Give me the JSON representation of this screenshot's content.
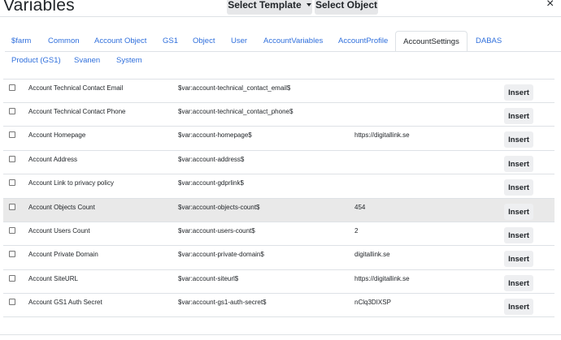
{
  "header": {
    "title": "Variables",
    "select_template_label": "Select Template",
    "select_object_label": "Select Object",
    "close_glyph": "×"
  },
  "tabs": [
    {
      "label": "$farm",
      "active": false
    },
    {
      "label": "Common",
      "active": false
    },
    {
      "label": "Account Object",
      "active": false
    },
    {
      "label": "GS1",
      "active": false
    },
    {
      "label": "Object",
      "active": false
    },
    {
      "label": "User",
      "active": false
    },
    {
      "label": "AccountVariables",
      "active": false
    },
    {
      "label": "AccountProfile",
      "active": false
    },
    {
      "label": "AccountSettings",
      "active": true
    },
    {
      "label": "DABAS",
      "active": false
    },
    {
      "label": "Product (GS1)",
      "active": false
    },
    {
      "label": "Svanen",
      "active": false
    },
    {
      "label": "System",
      "active": false
    }
  ],
  "rows": [
    {
      "name": "Account Technical Contact Email",
      "variable": "$var:account-technical_contact_email$",
      "value": "",
      "action": "Insert",
      "highlighted": false
    },
    {
      "name": "Account Technical Contact Phone",
      "variable": "$var:account-technical_contact_phone$",
      "value": "",
      "action": "Insert",
      "highlighted": false
    },
    {
      "name": "Account Homepage",
      "variable": "$var:account-homepage$",
      "value": "https://digitallink.se",
      "action": "Insert",
      "highlighted": false
    },
    {
      "name": "Account Address",
      "variable": "$var:account-address$",
      "value": "",
      "action": "Insert",
      "highlighted": false
    },
    {
      "name": "Account Link to privacy policy",
      "variable": "$var:account-gdprlink$",
      "value": "",
      "action": "Insert",
      "highlighted": false
    },
    {
      "name": "Account Objects Count",
      "variable": "$var:account-objects-count$",
      "value": "454",
      "action": "Insert",
      "highlighted": true
    },
    {
      "name": "Account Users Count",
      "variable": "$var:account-users-count$",
      "value": "2",
      "action": "Insert",
      "highlighted": false
    },
    {
      "name": "Account Private Domain",
      "variable": "$var:account-private-domain$",
      "value": "digitallink.se",
      "action": "Insert",
      "highlighted": false
    },
    {
      "name": "Account SiteURL",
      "variable": "$var:account-siteurl$",
      "value": "https://digitallink.se",
      "action": "Insert",
      "highlighted": false
    },
    {
      "name": "Account GS1 Auth Secret",
      "variable": "$var:account-gs1-auth-secret$",
      "value": "nClq3DIXSP",
      "action": "Insert",
      "highlighted": false
    }
  ]
}
